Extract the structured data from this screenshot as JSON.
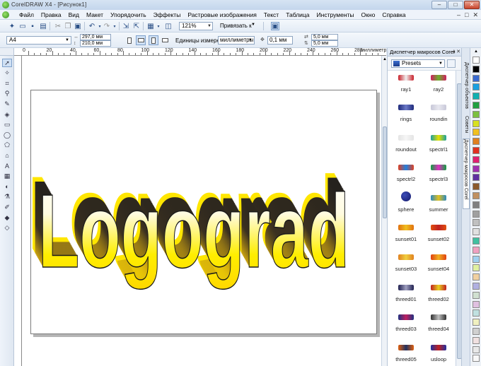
{
  "window": {
    "title": "CorelDRAW X4 - [Рисунок1]",
    "controls": [
      "–",
      "□",
      "✕"
    ]
  },
  "menu": {
    "items": [
      "Файл",
      "Правка",
      "Вид",
      "Макет",
      "Упорядочить",
      "Эффекты",
      "Растровые изображения",
      "Текст",
      "Таблица",
      "Инструменты",
      "Окно",
      "Справка"
    ],
    "mdi_controls": [
      "–",
      "□",
      "✕"
    ]
  },
  "toolbar": {
    "zoom_value": "121%",
    "snap_label": "Привязать к"
  },
  "property_bar": {
    "paper_size": "A4",
    "width": "297,0 мм",
    "height": "210,0 мм",
    "units_label": "Единицы измерения:",
    "units_value": "миллиметры",
    "nudge": "0,1 мм",
    "dup_x": "5,0 мм",
    "dup_y": "5,0 мм"
  },
  "ruler": {
    "labels": [
      "0",
      "20",
      "40",
      "60",
      "80",
      "100",
      "120",
      "140",
      "160",
      "180",
      "200",
      "220",
      "240",
      "260",
      "280"
    ],
    "unit": "миллиметры"
  },
  "artwork": {
    "text": "Logograd",
    "front_color": "#ffe600",
    "extrude_color": "#1a1a1a"
  },
  "docker": {
    "title": "Диспетчер макросов Corel",
    "preset_select": "Presets",
    "presets": [
      {
        "name": "ray1",
        "colors": [
          "#c8202a",
          "#f0f0f0"
        ]
      },
      {
        "name": "ray2",
        "colors": [
          "#d01c60",
          "#6ab02c"
        ]
      },
      {
        "name": "rings",
        "colors": [
          "#1e2a7a",
          "#6c7ac8"
        ]
      },
      {
        "name": "roundin",
        "colors": [
          "#c8c8d8",
          "#e8e8f0"
        ]
      },
      {
        "name": "roundout",
        "colors": [
          "#e4e4e4",
          "#f6f6f6"
        ]
      },
      {
        "name": "spectrl1",
        "colors": [
          "#1aa0a0",
          "#e8e000"
        ]
      },
      {
        "name": "spectrl2",
        "colors": [
          "#e04020",
          "#2080e0"
        ]
      },
      {
        "name": "spectrl3",
        "colors": [
          "#10a040",
          "#e030c0"
        ]
      },
      {
        "name": "sphere",
        "colors": [
          "#141a6a",
          "#3c4cb8"
        ]
      },
      {
        "name": "summer",
        "colors": [
          "#2a8ac0",
          "#e0c020"
        ]
      },
      {
        "name": "sunset01",
        "colors": [
          "#e07010",
          "#f0c020"
        ]
      },
      {
        "name": "sunset02",
        "colors": [
          "#e05010",
          "#c02020"
        ]
      },
      {
        "name": "sunset03",
        "colors": [
          "#e08020",
          "#f0d040"
        ]
      },
      {
        "name": "sunset04",
        "colors": [
          "#e04010",
          "#f0b020"
        ]
      },
      {
        "name": "threed01",
        "colors": [
          "#202050",
          "#a0a0c0"
        ]
      },
      {
        "name": "threed02",
        "colors": [
          "#c02020",
          "#e8d020"
        ]
      },
      {
        "name": "threed03",
        "colors": [
          "#203080",
          "#c02060"
        ]
      },
      {
        "name": "threed04",
        "colors": [
          "#303030",
          "#c0c0c0"
        ]
      },
      {
        "name": "threed05",
        "colors": [
          "#e06010",
          "#203060"
        ]
      },
      {
        "name": "usloop",
        "colors": [
          "#2030a0",
          "#c02020"
        ]
      }
    ]
  },
  "side_tabs": [
    "Диспетчер объектов",
    "Советы",
    "Диспетчер макросов Corel"
  ],
  "palette": [
    "#ffffff",
    "#000000",
    "#3a6ad0",
    "#1aa0e0",
    "#10b0b0",
    "#20a040",
    "#7cc040",
    "#d8e020",
    "#f0c020",
    "#e08020",
    "#e03020",
    "#e02070",
    "#a030b0",
    "#6030a0",
    "#8b5a2b",
    "#c09060",
    "#808080",
    "#a0a0a0",
    "#c0c0c0",
    "#e0e0e0",
    "#40c0a0",
    "#f0a0c0",
    "#a0d0f0",
    "#e0f0a0",
    "#f0d0a0",
    "#b0b0e0",
    "#d0e0d0",
    "#e0c0e0",
    "#c0e0e0",
    "#f0f0c0",
    "#d0d0d0",
    "#f0e0e0",
    "#e8e8e8",
    "#f8f8f8"
  ]
}
